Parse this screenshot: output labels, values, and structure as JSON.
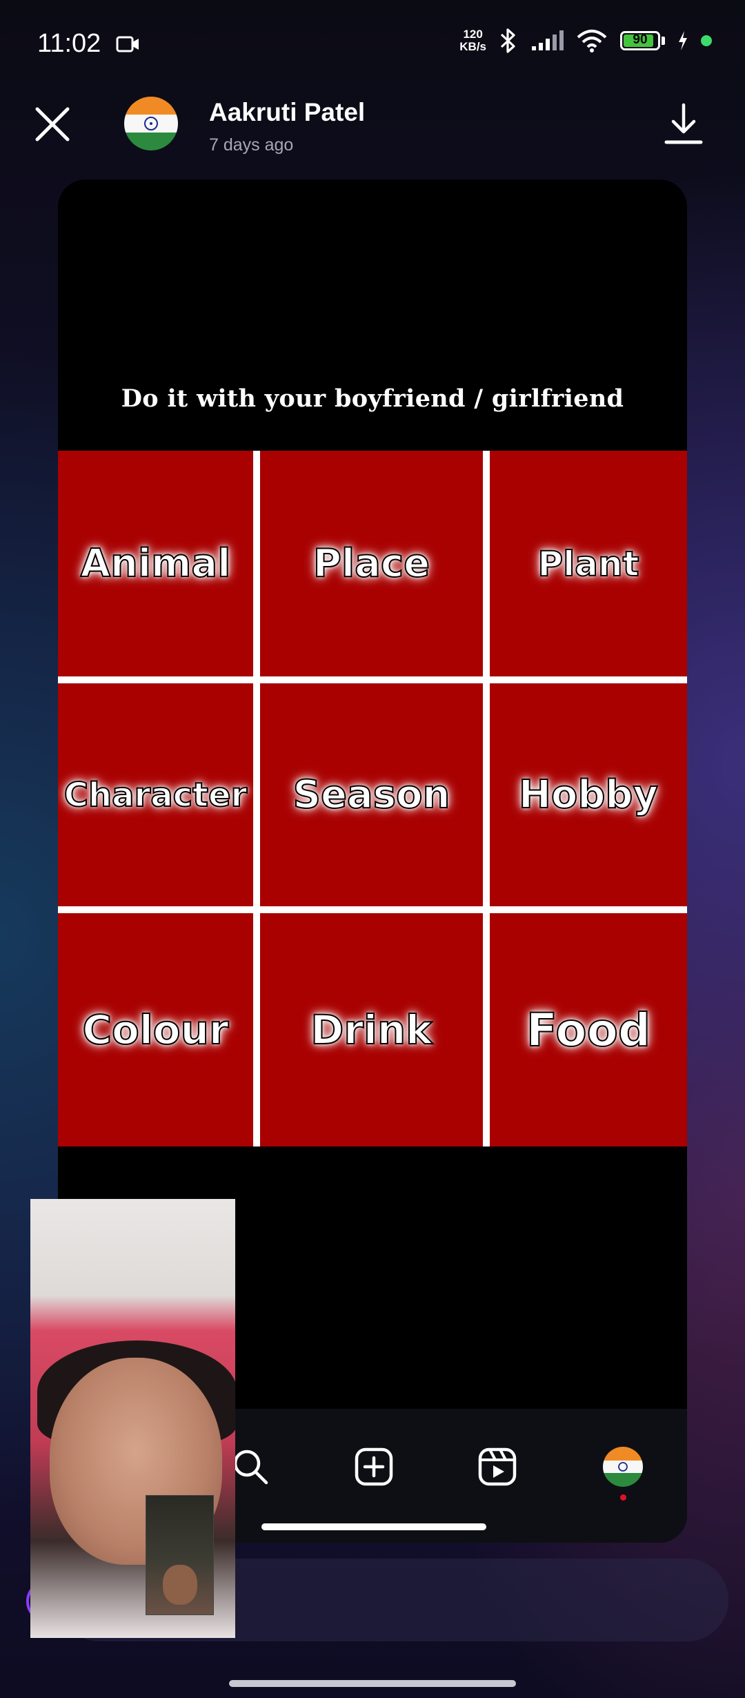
{
  "status_bar": {
    "time": "11:02",
    "net_speed_value": "120",
    "net_speed_unit": "KB/s",
    "battery": "90",
    "battery_fraction": 0.9,
    "icons": [
      "video-call-icon",
      "bluetooth-icon",
      "signal-icon",
      "wifi-icon",
      "battery-icon",
      "charging-icon"
    ]
  },
  "header": {
    "user_name": "Aakruti Patel",
    "posted_time": "7 days ago",
    "avatar": "india-flag-avatar"
  },
  "story": {
    "caption": "Do it with your boyfriend / girlfriend",
    "cell_color": "#a90000",
    "grid": [
      [
        "Animal",
        "Place",
        "Plant"
      ],
      [
        "Character",
        "Season",
        "Hobby"
      ],
      [
        "Colour",
        "Drink",
        "Food"
      ]
    ]
  },
  "nav": {
    "items": [
      "search-icon",
      "create-icon",
      "reels-icon",
      "profile-avatar"
    ]
  },
  "colors": {
    "accent_red": "#e0102a",
    "battery_green": "#44c33c"
  }
}
